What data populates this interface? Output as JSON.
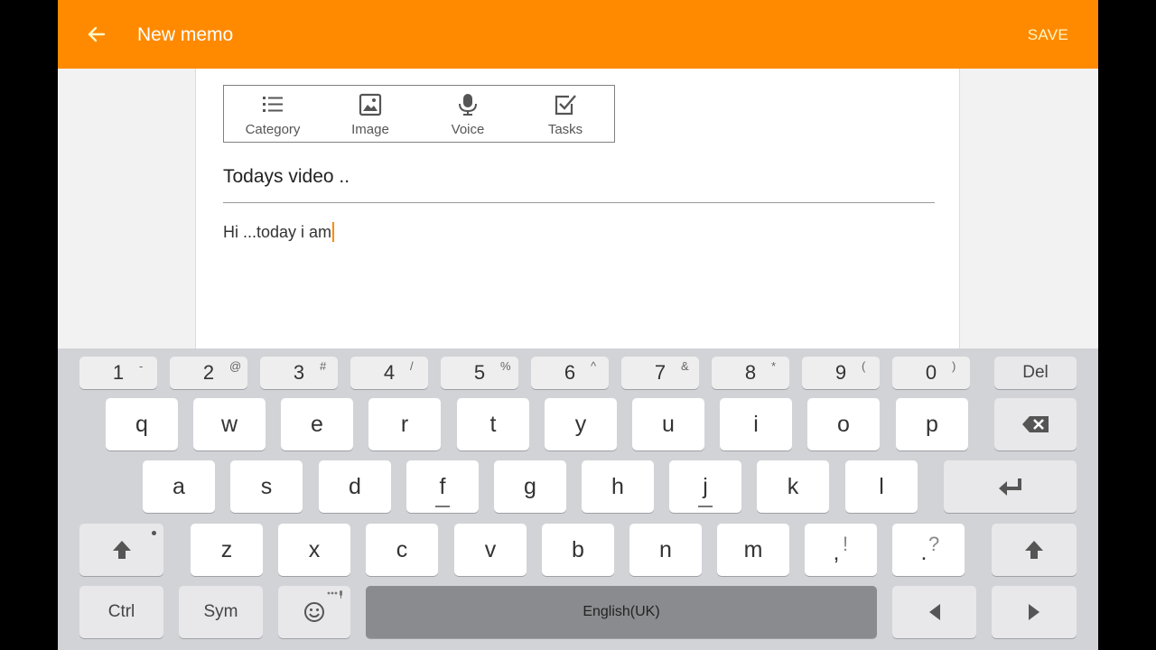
{
  "header": {
    "title": "New memo",
    "save_label": "SAVE",
    "accent_color": "#ff8a00"
  },
  "toolbar": {
    "items": [
      {
        "label": "Category",
        "icon": "list-icon"
      },
      {
        "label": "Image",
        "icon": "image-icon"
      },
      {
        "label": "Voice",
        "icon": "microphone-icon"
      },
      {
        "label": "Tasks",
        "icon": "checkbox-icon"
      }
    ]
  },
  "memo": {
    "title": "Todays video ..",
    "body": "Hi ...today i am"
  },
  "keyboard": {
    "number_row": [
      {
        "main": "1",
        "sub": "-"
      },
      {
        "main": "2",
        "sub": "@"
      },
      {
        "main": "3",
        "sub": "#"
      },
      {
        "main": "4",
        "sub": "/"
      },
      {
        "main": "5",
        "sub": "%"
      },
      {
        "main": "6",
        "sub": "^"
      },
      {
        "main": "7",
        "sub": "&"
      },
      {
        "main": "8",
        "sub": "*"
      },
      {
        "main": "9",
        "sub": "("
      },
      {
        "main": "0",
        "sub": ")"
      }
    ],
    "del_label": "Del",
    "row1": [
      "q",
      "w",
      "e",
      "r",
      "t",
      "y",
      "u",
      "i",
      "o",
      "p"
    ],
    "row2": [
      "a",
      "s",
      "d",
      "f",
      "g",
      "h",
      "j",
      "k",
      "l"
    ],
    "row3": [
      "z",
      "x",
      "c",
      "v",
      "b",
      "n",
      "m"
    ],
    "punct1": {
      "main": ",",
      "sub": "!"
    },
    "punct2": {
      "main": ".",
      "sub": "?"
    },
    "ctrl_label": "Ctrl",
    "sym_label": "Sym",
    "space_label": "English(UK)"
  }
}
